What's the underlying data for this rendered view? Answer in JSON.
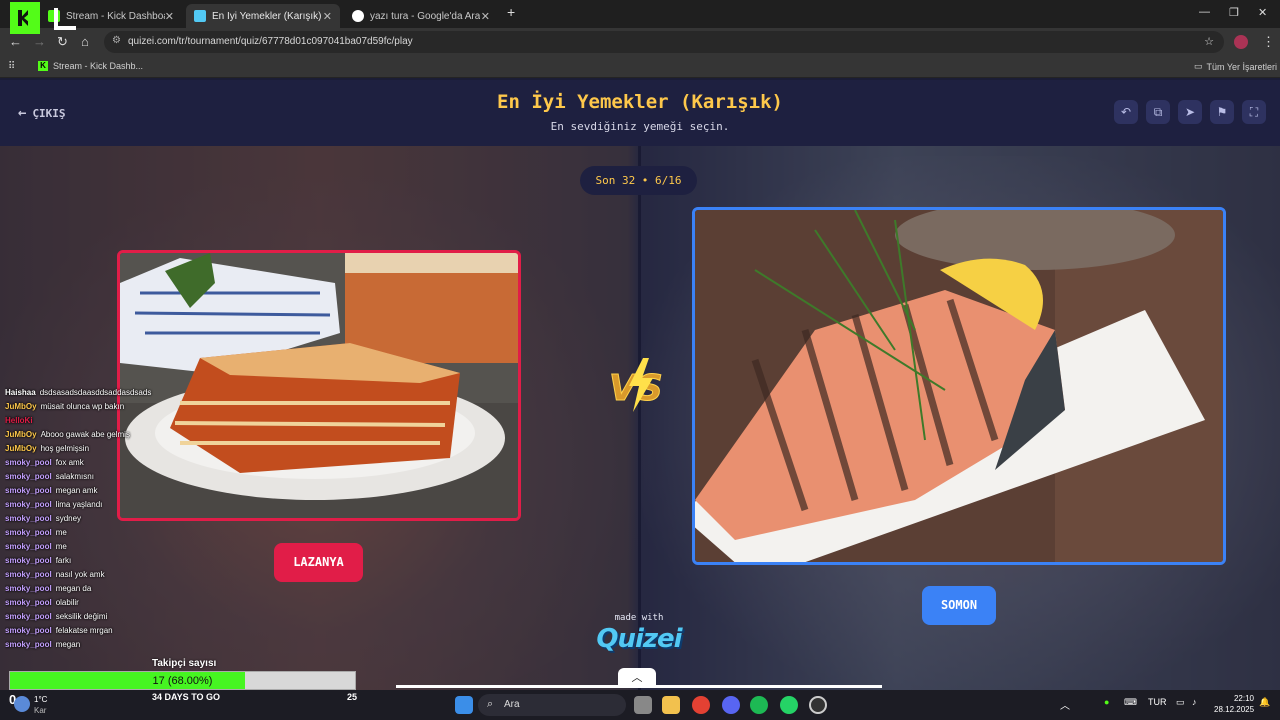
{
  "browser": {
    "tabs": [
      {
        "title": "Stream - Kick Dashboard"
      },
      {
        "title": "En İyi Yemekler (Karışık) - Tier Lis"
      },
      {
        "title": "yazı tura - Google'da Ara"
      }
    ],
    "url": "quizei.com/tr/tournament/quiz/67778d01c097041ba07d59fc/play",
    "bookmarks": [
      {
        "label": "Stream - Kick Dashb..."
      }
    ],
    "all_bookmarks_label": "Tüm Yer İşaretleri"
  },
  "quiz": {
    "exit_label": "ÇIKIŞ",
    "title": "En İyi Yemekler (Karışık)",
    "subtitle": "En sevdiğiniz yemeği seçin.",
    "round_label": "Son 32 • 6/16",
    "vs_label": "VS",
    "left_choice": {
      "label": "LAZANYA"
    },
    "right_choice": {
      "label": "SOMON"
    },
    "made_with": "made with",
    "brand": "Quizei",
    "colors": {
      "accent": "#fec84b",
      "left": "#e11d48",
      "right": "#3b82f6"
    }
  },
  "chat": [
    {
      "user": "Haishaa",
      "msg": "dsdsasadsdaasddsaddasdsads",
      "color": "#ffffff"
    },
    {
      "user": "JuMbOy",
      "msg": "müsait olunca wp bakın",
      "color": "#fec84b"
    },
    {
      "user": "HelloKi",
      "msg": "",
      "color": "#e11d48"
    },
    {
      "user": "JuMbOy",
      "msg": "Abooo gawak abe gelmiş",
      "color": "#fec84b"
    },
    {
      "user": "JuMbOy",
      "msg": "hoş gelmişsin",
      "color": "#fec84b"
    },
    {
      "user": "smoky_pool",
      "msg": "fox amk",
      "color": "#c4a0ff"
    },
    {
      "user": "smoky_pool",
      "msg": "salakmısnı",
      "color": "#c4a0ff"
    },
    {
      "user": "smoky_pool",
      "msg": "megan amk",
      "color": "#c4a0ff"
    },
    {
      "user": "smoky_pool",
      "msg": "lima yaşlandı",
      "color": "#c4a0ff"
    },
    {
      "user": "smoky_pool",
      "msg": "sydney",
      "color": "#c4a0ff"
    },
    {
      "user": "smoky_pool",
      "msg": "me",
      "color": "#c4a0ff"
    },
    {
      "user": "smoky_pool",
      "msg": "me",
      "color": "#c4a0ff"
    },
    {
      "user": "smoky_pool",
      "msg": "farkı",
      "color": "#c4a0ff"
    },
    {
      "user": "smoky_pool",
      "msg": "nasıl yok amk",
      "color": "#c4a0ff"
    },
    {
      "user": "smoky_pool",
      "msg": "megan da",
      "color": "#c4a0ff"
    },
    {
      "user": "smoky_pool",
      "msg": "olabilir",
      "color": "#c4a0ff"
    },
    {
      "user": "smoky_pool",
      "msg": "seksilik değimi",
      "color": "#c4a0ff"
    },
    {
      "user": "smoky_pool",
      "msg": "felakatse mrgan",
      "color": "#c4a0ff"
    },
    {
      "user": "smoky_pool",
      "msg": "megan",
      "color": "#c4a0ff"
    }
  ],
  "follower_goal": {
    "title": "Takipçi sayısı",
    "progress_text": "17 (68.00%)",
    "progress": 0.68,
    "days_label": "34 DAYS TO GO",
    "target": "25",
    "current": "0"
  },
  "taskbar": {
    "weather_temp": "1°C",
    "weather_desc": "Kar",
    "search_placeholder": "Ara",
    "language": "TUR",
    "time": "22:10",
    "date": "28.12.2025"
  }
}
